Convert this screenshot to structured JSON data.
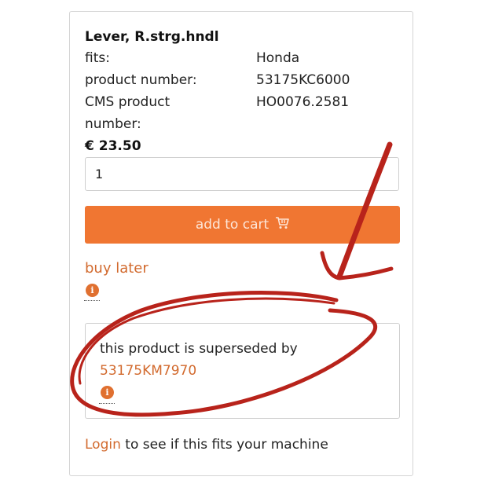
{
  "product": {
    "title": "Lever, R.strg.hndl",
    "fits_label": "fits:",
    "fits_value": "Honda",
    "product_number_label": "product number:",
    "product_number_value": "53175KC6000",
    "cms_label_line1": "CMS product",
    "cms_label_line2": "number:",
    "cms_value": "HO0076.2581",
    "price": "€ 23.50"
  },
  "quantity": {
    "value": "1"
  },
  "add_to_cart": {
    "label": "add to cart",
    "icon": "cart-icon",
    "color": "#f07632"
  },
  "buy_later": {
    "label": "buy later",
    "icon": "info-icon"
  },
  "supersede": {
    "text": "this product is superseded by",
    "link": "53175KM7970",
    "icon": "info-icon"
  },
  "login": {
    "link": "Login",
    "text": " to see if this fits your machine"
  },
  "colors": {
    "accent": "#d26a2e",
    "annotation": "#b8231b"
  }
}
